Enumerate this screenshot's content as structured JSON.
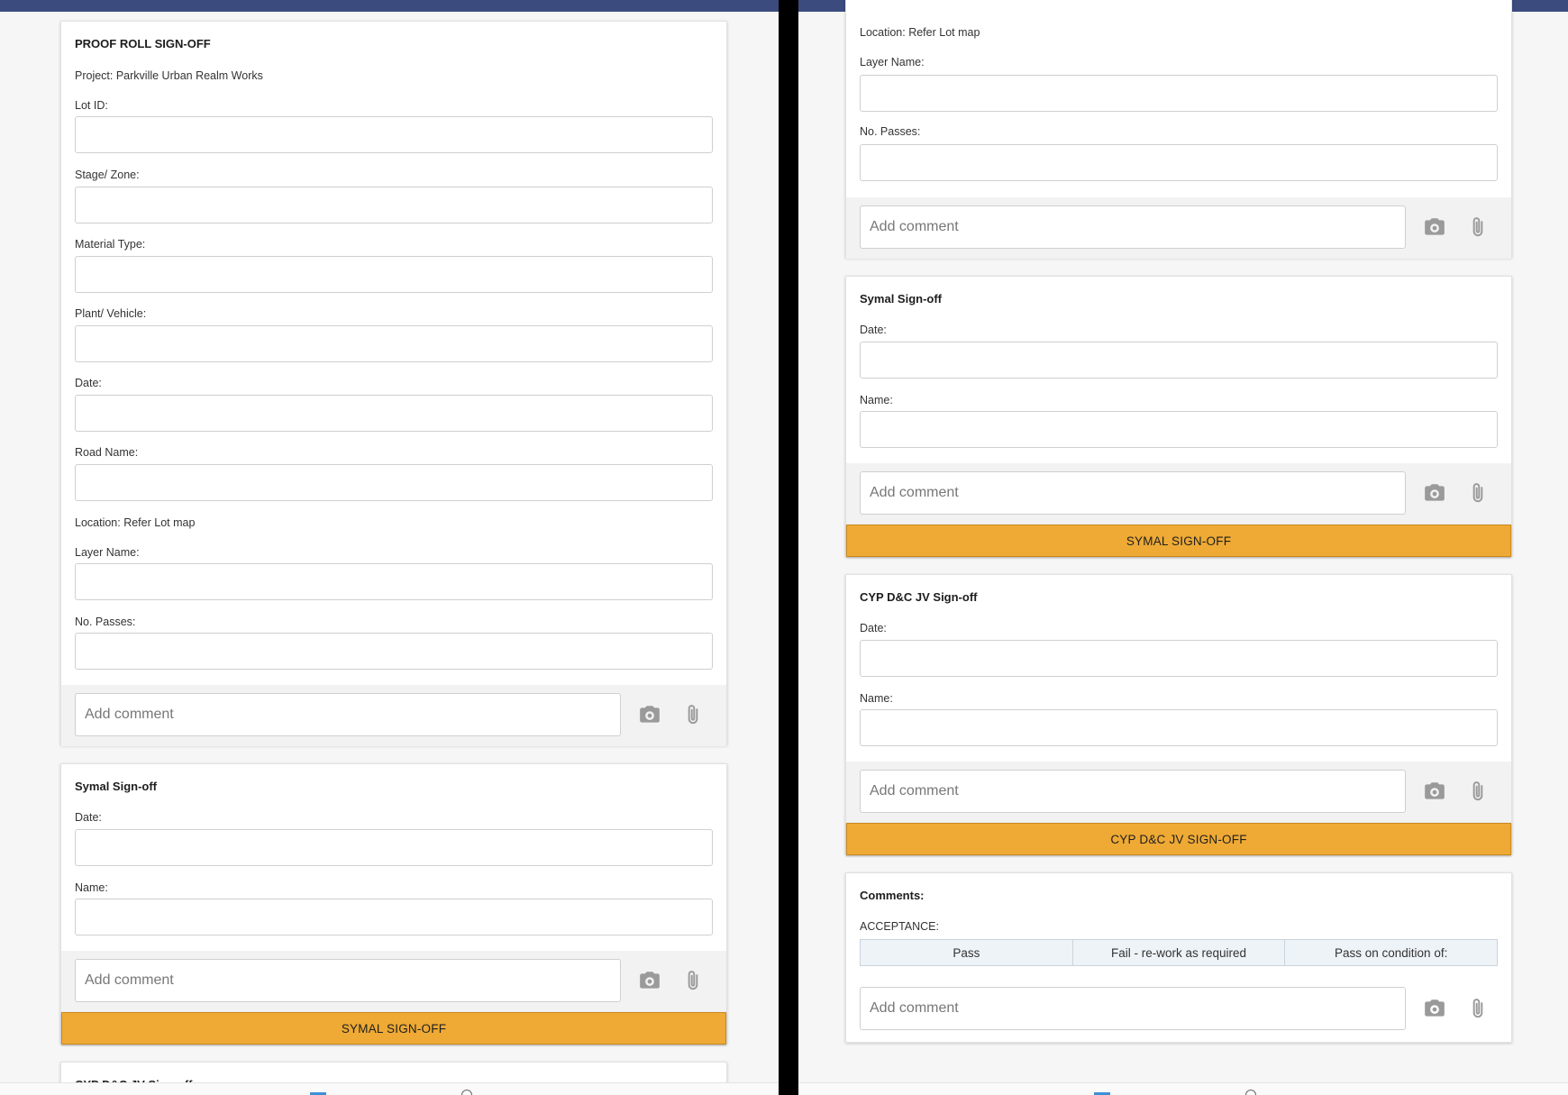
{
  "form": {
    "title": "PROOF ROLL SIGN-OFF",
    "project": "Project: Parkville Urban Realm Works",
    "location": "Location: Refer Lot map",
    "fields": {
      "lot_id": "Lot ID:",
      "stage_zone": "Stage/ Zone:",
      "material_type": "Material Type:",
      "plant_vehicle": "Plant/ Vehicle:",
      "date": "Date:",
      "road_name": "Road Name:",
      "layer_name": "Layer Name:",
      "no_passes": "No. Passes:"
    }
  },
  "comment": {
    "placeholder": "Add comment"
  },
  "icons": {
    "camera": "camera-icon",
    "attach": "paperclip-icon"
  },
  "symal": {
    "title": "Symal Sign-off",
    "date_label": "Date:",
    "name_label": "Name:",
    "button": "SYMAL SIGN-OFF"
  },
  "cyp": {
    "title": "CYP D&C JV Sign-off",
    "date_label": "Date:",
    "name_label": "Name:",
    "button": "CYP D&C JV SIGN-OFF"
  },
  "comments_section": {
    "title": "Comments:",
    "acceptance_label": "ACCEPTANCE:",
    "options": [
      "Pass",
      "Fail - re-work as required",
      "Pass on condition of:"
    ]
  },
  "colors": {
    "top_bar": "#3c4b7e",
    "signoff_button": "#eeaa35",
    "page_background": "#f6f6f6"
  }
}
